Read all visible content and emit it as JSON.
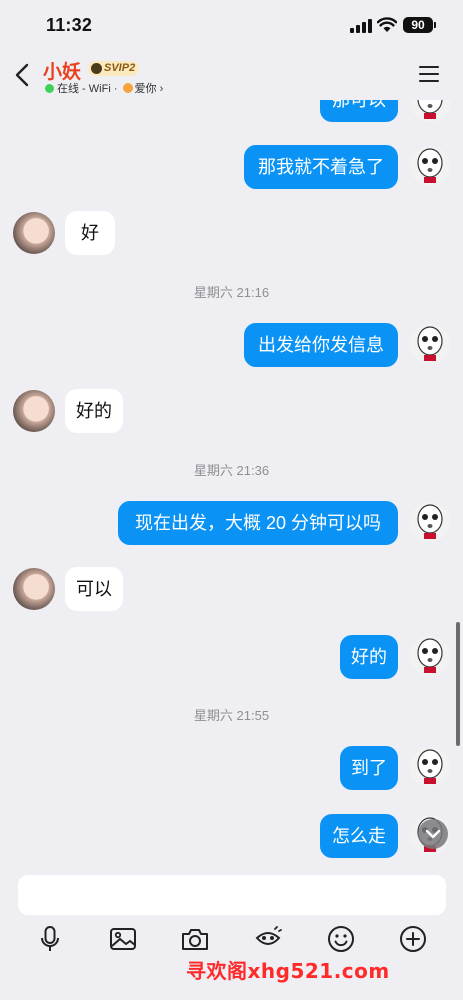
{
  "status_bar": {
    "time": "11:32",
    "battery": "90"
  },
  "header": {
    "contact_name": "小妖",
    "badge": "SVIP2",
    "online_status": "在线 - WiFi ·",
    "mood": "爱你",
    "chevron": "›"
  },
  "messages": [
    {
      "type": "out",
      "text": "那可以"
    },
    {
      "type": "out",
      "text": "那我就不着急了"
    },
    {
      "type": "in",
      "text": "好"
    },
    {
      "type": "time",
      "text": "星期六 21:16"
    },
    {
      "type": "out",
      "text": "出发给你发信息"
    },
    {
      "type": "in",
      "text": "好的"
    },
    {
      "type": "time",
      "text": "星期六 21:36"
    },
    {
      "type": "out",
      "text": "现在出发，大概 20 分钟可以吗"
    },
    {
      "type": "in",
      "text": "可以"
    },
    {
      "type": "out",
      "text": "好的"
    },
    {
      "type": "time",
      "text": "星期六 21:55"
    },
    {
      "type": "out",
      "text": "到了"
    },
    {
      "type": "out",
      "text": "怎么走"
    }
  ],
  "input": {
    "placeholder": ""
  },
  "toolbar": [
    "microphone-icon",
    "image-icon",
    "camera-icon",
    "gift-icon",
    "emoji-icon",
    "plus-icon"
  ],
  "watermark": "寻欢阁xhg521.com",
  "colors": {
    "accent": "#0a93f5",
    "name": "#e8401c",
    "online": "#3dd158",
    "watermark": "#ff2a2a"
  }
}
